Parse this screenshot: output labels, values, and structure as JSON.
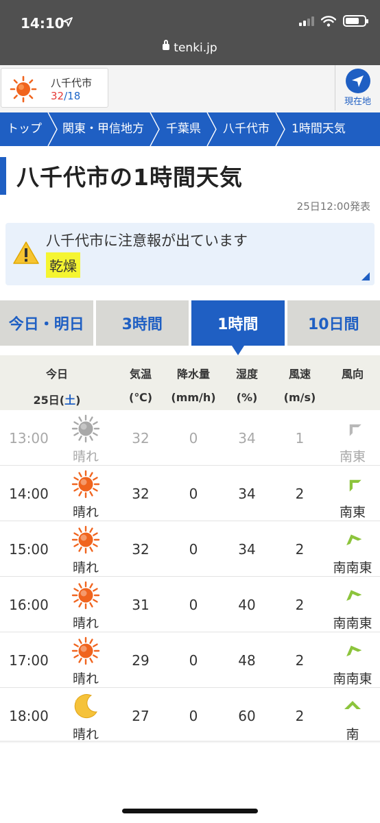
{
  "status_bar": {
    "time": "14:10"
  },
  "browser": {
    "url": "tenki.jp"
  },
  "location_card": {
    "city": "八千代市",
    "high": "32",
    "sep": "/",
    "low": "18"
  },
  "gps_button": {
    "label": "現在地"
  },
  "breadcrumb": [
    "トップ",
    "関東・甲信地方",
    "千葉県",
    "八千代市",
    "1時間天気"
  ],
  "page": {
    "title": "八千代市の1時間天気",
    "issued": "25日12:00発表"
  },
  "warning": {
    "text": "八千代市に注意報が出ています",
    "badge": "乾燥"
  },
  "tabs": [
    {
      "label": "今日・明日",
      "active": false
    },
    {
      "label": "3時間",
      "active": false
    },
    {
      "label": "1時間",
      "active": true
    },
    {
      "label": "10日間",
      "active": false
    }
  ],
  "table": {
    "headers": {
      "day_label": "今日",
      "date_prefix": "25日(",
      "date_weekday": "土",
      "date_suffix": ")",
      "temp": "気温",
      "temp_unit": "(℃)",
      "precip": "降水量",
      "precip_unit": "(mm/h)",
      "humidity": "湿度",
      "humidity_unit": "(%)",
      "wind_speed": "風速",
      "wind_speed_unit": "(m/s)",
      "wind_dir": "風向"
    },
    "rows": [
      {
        "time": "13:00",
        "icon": "sun-icon",
        "weather": "晴れ",
        "temp": "32",
        "precip": "0",
        "humidity": "34",
        "wind_speed": "1",
        "wind_dir": "南東",
        "past": true
      },
      {
        "time": "14:00",
        "icon": "sun-icon",
        "weather": "晴れ",
        "temp": "32",
        "precip": "0",
        "humidity": "34",
        "wind_speed": "2",
        "wind_dir": "南東",
        "past": false
      },
      {
        "time": "15:00",
        "icon": "sun-icon",
        "weather": "晴れ",
        "temp": "32",
        "precip": "0",
        "humidity": "34",
        "wind_speed": "2",
        "wind_dir": "南南東",
        "past": false
      },
      {
        "time": "16:00",
        "icon": "sun-icon",
        "weather": "晴れ",
        "temp": "31",
        "precip": "0",
        "humidity": "40",
        "wind_speed": "2",
        "wind_dir": "南南東",
        "past": false
      },
      {
        "time": "17:00",
        "icon": "sun-icon",
        "weather": "晴れ",
        "temp": "29",
        "precip": "0",
        "humidity": "48",
        "wind_speed": "2",
        "wind_dir": "南南東",
        "past": false
      },
      {
        "time": "18:00",
        "icon": "moon-icon",
        "weather": "晴れ",
        "temp": "27",
        "precip": "0",
        "humidity": "60",
        "wind_speed": "2",
        "wind_dir": "南",
        "past": false
      }
    ]
  },
  "colors": {
    "brand_blue": "#1f5fc3",
    "sun_orange": "#f0641e",
    "past_gray": "#a8a8a8",
    "wind_green": "#8cc43c",
    "warning_badge": "#f5f531",
    "temp_high": "#e53935"
  }
}
